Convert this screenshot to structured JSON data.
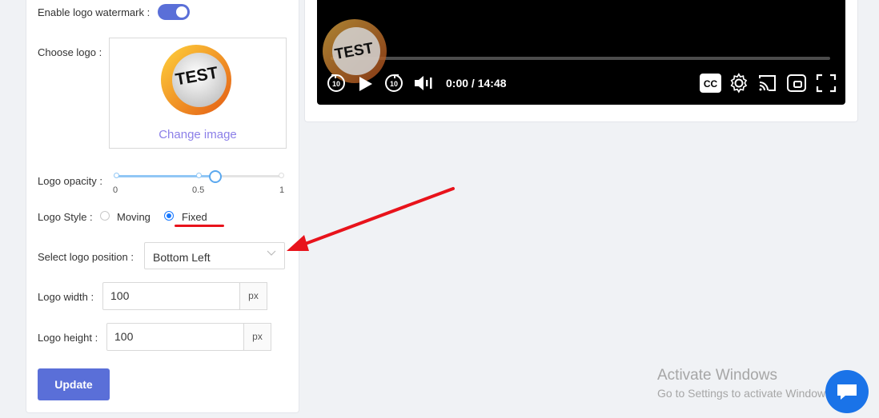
{
  "settings": {
    "watermark_label": "Enable logo watermark",
    "watermark_enabled": true,
    "choose_logo_label": "Choose logo",
    "logo_text": "TEST",
    "change_image": "Change image",
    "opacity_label": "Logo opacity",
    "opacity_value": 0.6,
    "opacity_ticks": [
      "0",
      "0.5",
      "1"
    ],
    "style_label": "Logo Style",
    "style_options": [
      "Moving",
      "Fixed"
    ],
    "style_selected": "Fixed",
    "position_label": "Select logo position",
    "position_value": "Bottom Left",
    "width_label": "Logo width",
    "width_value": "100",
    "height_label": "Logo height",
    "height_value": "100",
    "unit": "px",
    "update_button": "Update"
  },
  "player": {
    "watermark_text": "TEST",
    "current_time": "0:00",
    "separator": "/",
    "duration": "14:48",
    "skip_back": "10",
    "skip_forward": "10",
    "cc": "CC",
    "icons": [
      "replay-10-icon",
      "play-icon",
      "forward-10-icon",
      "volume-icon",
      "cc-icon",
      "settings-icon",
      "cast-icon",
      "pip-icon",
      "fullscreen-icon"
    ]
  },
  "windows": {
    "activate_title": "Activate Windows",
    "activate_sub": "Go to Settings to activate Windows."
  },
  "colors": {
    "accent": "#5a6fd8",
    "link": "#8b7fe8",
    "annotation": "#e8131b",
    "radio_active": "#1677ff",
    "chat": "#1a73e8"
  }
}
